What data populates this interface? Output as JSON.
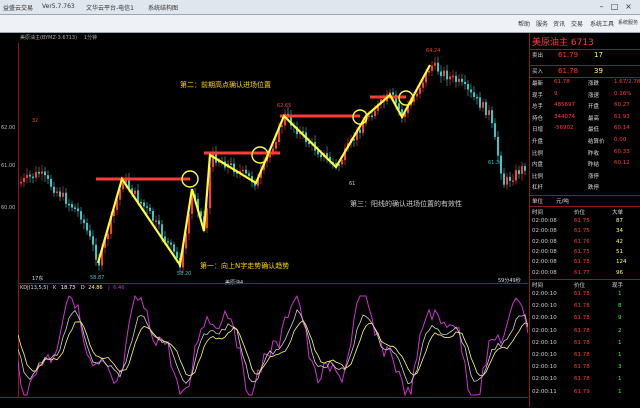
{
  "window": {
    "app_name": "益盛云交易",
    "version": "Ver5.7.763",
    "doc": "文华云平台-电信1",
    "tab": "系统结构图",
    "buttons": [
      "–",
      "□",
      "×"
    ]
  },
  "menu": {
    "items": [
      "帮助",
      "服务",
      "资讯",
      "交易",
      "系统工具",
      "系统服务"
    ]
  },
  "chart_toolbar": {
    "symbol": "美原油主(BYMZ-3.6713)",
    "period": "1分钟"
  },
  "price_axis": {
    "labels": [
      "62.00",
      "61.00",
      "60.00"
    ]
  },
  "price_labels": {
    "low1": "58.87",
    "low2": "58.20",
    "mid1": "62.65",
    "high": "64.24",
    "right_low": "61.36",
    "left_top": "32",
    "mid_small": "61"
  },
  "annotations": {
    "a1": "第一：向上N字走势确认趋势",
    "a2": "第二：前期高点确认进场位置",
    "a3": "第三：阳线的确认进场位置的有效性"
  },
  "bottom_bar": {
    "left": "17东",
    "center": "美原油4",
    "right": "59分49秒"
  },
  "kdj": {
    "name": "KDJ(13,5,5)",
    "k_label": "K",
    "k_value": "18.73",
    "d_label": "D",
    "d_value": "24.86",
    "j_label": "J",
    "j_value": "6.46"
  },
  "side": {
    "title": "美原油主  6713",
    "sell": {
      "label": "卖出",
      "price": "61.79",
      "vol": "17"
    },
    "buy": {
      "label": "买入",
      "price": "61.78",
      "vol": "39"
    },
    "stats": [
      [
        "最新",
        "61.78",
        "涨跌",
        "1.67/2.78%"
      ],
      [
        "现手",
        "9",
        "涨速",
        "0.16%"
      ],
      [
        "总手",
        "485697",
        "开盘",
        "60.27"
      ],
      [
        "持仓",
        "344074",
        "最高",
        "61.93"
      ],
      [
        "日增",
        "-56902",
        "最低",
        "60.14"
      ],
      [
        "升盘",
        "",
        "结算价",
        "0.00"
      ],
      [
        "比例",
        "",
        "昨收",
        "60.33"
      ],
      [
        "内盘",
        "",
        "昨结",
        "60.12"
      ],
      [
        "比例",
        "",
        "涨停",
        ""
      ],
      [
        "杠杆",
        "",
        "跌停",
        ""
      ]
    ],
    "unit_label": "单位",
    "unit_value": "元/吨",
    "trades_header": [
      "时间",
      "价位",
      "大单"
    ],
    "trades": [
      [
        "02:00:08",
        "61.75",
        "87"
      ],
      [
        "02:00:08",
        "61.75",
        "34"
      ],
      [
        "02:00:08",
        "61.76",
        "42"
      ],
      [
        "02:00:08",
        "61.75",
        "51"
      ],
      [
        "02:00:08",
        "61.78",
        "124"
      ],
      [
        "02:00:08",
        "61.77",
        "96"
      ]
    ],
    "ticks_header": [
      "时间",
      "价位",
      "现手"
    ],
    "ticks": [
      [
        "02:00:10",
        "61.78",
        "1"
      ],
      [
        "02:00:10",
        "61.78",
        "8"
      ],
      [
        "02:00:10",
        "61.78",
        "9"
      ],
      [
        "02:00:10",
        "61.78",
        "2"
      ],
      [
        "02:00:10",
        "61.78",
        "1"
      ],
      [
        "02:00:10",
        "61.78",
        "1"
      ],
      [
        "02:00:10",
        "61.78",
        "3"
      ],
      [
        "02:00:10",
        "61.78",
        "1"
      ],
      [
        "02:00:11",
        "61.79",
        "1"
      ]
    ]
  },
  "colors": {
    "up": "#ff3b3b",
    "down": "#36c8c8",
    "zigzag": "#ffff33",
    "level": "#ff3b3b",
    "kline": "#cfcfcf",
    "dline": "#ffff66",
    "jline": "#cc33cc"
  }
}
